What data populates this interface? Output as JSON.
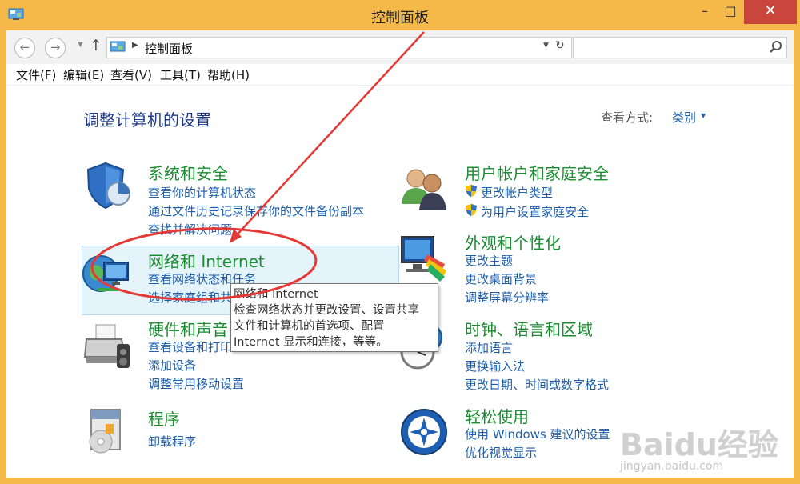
{
  "window": {
    "title": "控制面板",
    "minimize": "–",
    "maximize": "□",
    "close": "✕"
  },
  "nav": {
    "back": "←",
    "forward": "→",
    "address": "控制面板",
    "search_placeholder": ""
  },
  "menu": [
    "文件(F)",
    "编辑(E)",
    "查看(V)",
    "工具(T)",
    "帮助(H)"
  ],
  "heading": "调整计算机的设置",
  "view_by": {
    "label": "查看方式:",
    "value": "类别"
  },
  "categories": [
    {
      "title": "系统和安全",
      "links": [
        "查看你的计算机状态",
        "通过文件历史记录保存你的文件备份副本",
        "查找并解决问题"
      ]
    },
    {
      "title": "网络和 Internet",
      "links": [
        "查看网络状态和任务",
        "选择家庭组和共"
      ]
    },
    {
      "title": "硬件和声音",
      "links": [
        "查看设备和打印",
        "添加设备",
        "调整常用移动设置"
      ]
    },
    {
      "title": "程序",
      "links": [
        "卸载程序"
      ]
    },
    {
      "title": "用户帐户和家庭安全",
      "links": [
        "更改帐户类型",
        "为用户设置家庭安全"
      ]
    },
    {
      "title": "外观和个性化",
      "links": [
        "更改主题",
        "更改桌面背景",
        "调整屏幕分辨率"
      ]
    },
    {
      "title": "时钟、语言和区域",
      "links": [
        "添加语言",
        "更换输入法",
        "更改日期、时间或数字格式"
      ]
    },
    {
      "title": "轻松使用",
      "links": [
        "使用 Windows 建议的设置",
        "优化视觉显示"
      ]
    }
  ],
  "tooltip": {
    "title": "网络和 Internet",
    "lines": [
      "检查网络状态并更改设置、设置共享",
      "文件和计算机的首选项、配置",
      "Internet 显示和连接，等等。"
    ]
  },
  "watermark": {
    "text": "Baidu经验",
    "url": "jingyan.baidu.com"
  },
  "colors": {
    "title_bar": "#f5b94a",
    "close_button": "#c9463d",
    "category_title": "#1c8c33",
    "link": "#1e5eaa",
    "annotation": "#e53935"
  }
}
